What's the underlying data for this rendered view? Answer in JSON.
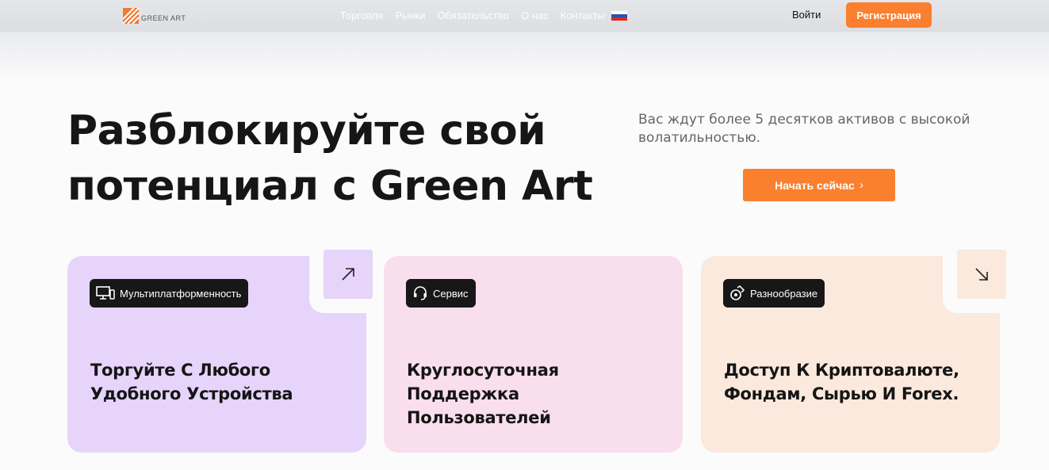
{
  "header": {
    "logo_text": "GREEN ART",
    "nav": [
      "Торговля",
      "Рынки",
      "Обязательство",
      "О нас",
      "Контакты"
    ],
    "language_flag": "russia-flag-icon",
    "login_label": "Войти",
    "register_label": "Регистрация"
  },
  "hero": {
    "title": "Разблокируйте свой потенциал с Green Art",
    "subtitle": "Вас ждут более 5 десятков активов с высокой волатильностью.",
    "cta_label": "Начать сейчас"
  },
  "cards": [
    {
      "badge": "Мультиплатформенность",
      "badge_icon": "devices-icon",
      "title": "Торгуйте С Любого Удобного Устройства",
      "corner_icon": "arrow-up-right-icon",
      "color": "#e6d4fa"
    },
    {
      "badge": "Сервис",
      "badge_icon": "headset-icon",
      "title": "Круглосуточная Поддержка Пользователей",
      "color": "#f9deed"
    },
    {
      "badge": "Разнообразие",
      "badge_icon": "coins-icon",
      "title": "Доступ К Криптовалюте, Фондам, Сырью И Forex.",
      "corner_icon": "arrow-down-right-icon",
      "color": "#fbe9dd"
    }
  ],
  "colors": {
    "accent": "#fa7f2e",
    "dark": "#171717"
  }
}
